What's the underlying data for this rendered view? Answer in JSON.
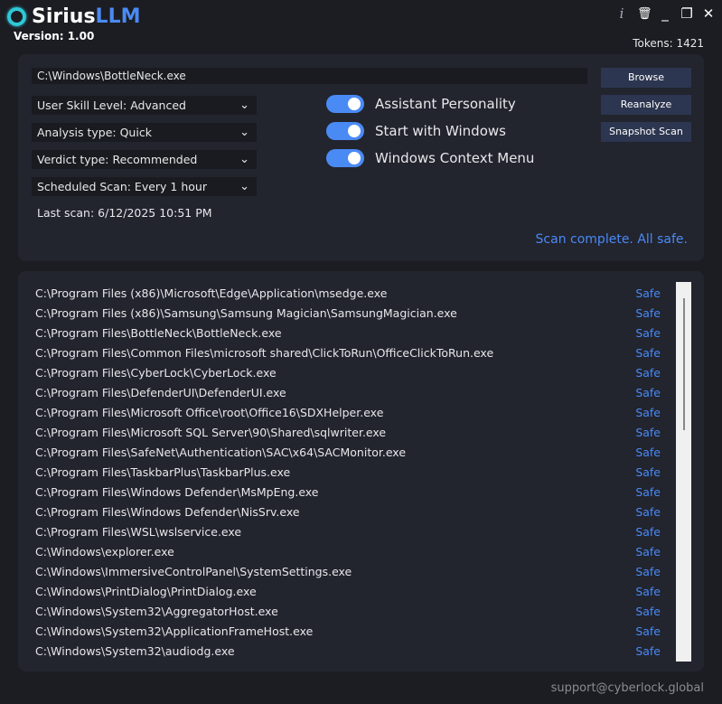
{
  "app": {
    "name_main": "Sirius",
    "name_accent": "LLM",
    "version": "Version: 1.00",
    "tokens": "Tokens: 1421"
  },
  "window_controls": {
    "info": "i",
    "delete": "🗑",
    "minimize": "_",
    "restore": "❐",
    "close": "✕"
  },
  "settings": {
    "file_path": "C:\\Windows\\BottleNeck.exe",
    "dropdowns": [
      {
        "label": "User Skill Level: Advanced"
      },
      {
        "label": "Analysis type: Quick"
      },
      {
        "label": "Verdict type: Recommended"
      },
      {
        "label": "Scheduled Scan: Every 1 hour"
      }
    ],
    "last_scan": "Last scan: 6/12/2025 10:51 PM",
    "toggles": [
      {
        "label": "Assistant Personality",
        "on": true
      },
      {
        "label": "Start with Windows",
        "on": true
      },
      {
        "label": "Windows Context Menu",
        "on": true
      }
    ],
    "buttons": {
      "browse": "Browse",
      "reanalyze": "Reanalyze",
      "snapshot": "Snapshot Scan"
    },
    "status": "Scan complete. All safe."
  },
  "results": [
    {
      "path": "C:\\Program Files (x86)\\Microsoft\\Edge\\Application\\msedge.exe",
      "verdict": "Safe"
    },
    {
      "path": "C:\\Program Files (x86)\\Samsung\\Samsung Magician\\SamsungMagician.exe",
      "verdict": "Safe"
    },
    {
      "path": "C:\\Program Files\\BottleNeck\\BottleNeck.exe",
      "verdict": "Safe"
    },
    {
      "path": "C:\\Program Files\\Common Files\\microsoft shared\\ClickToRun\\OfficeClickToRun.exe",
      "verdict": "Safe"
    },
    {
      "path": "C:\\Program Files\\CyberLock\\CyberLock.exe",
      "verdict": "Safe"
    },
    {
      "path": "C:\\Program Files\\DefenderUI\\DefenderUI.exe",
      "verdict": "Safe"
    },
    {
      "path": "C:\\Program Files\\Microsoft Office\\root\\Office16\\SDXHelper.exe",
      "verdict": "Safe"
    },
    {
      "path": "C:\\Program Files\\Microsoft SQL Server\\90\\Shared\\sqlwriter.exe",
      "verdict": "Safe"
    },
    {
      "path": "C:\\Program Files\\SafeNet\\Authentication\\SAC\\x64\\SACMonitor.exe",
      "verdict": "Safe"
    },
    {
      "path": "C:\\Program Files\\TaskbarPlus\\TaskbarPlus.exe",
      "verdict": "Safe"
    },
    {
      "path": "C:\\Program Files\\Windows Defender\\MsMpEng.exe",
      "verdict": "Safe"
    },
    {
      "path": "C:\\Program Files\\Windows Defender\\NisSrv.exe",
      "verdict": "Safe"
    },
    {
      "path": "C:\\Program Files\\WSL\\wslservice.exe",
      "verdict": "Safe"
    },
    {
      "path": "C:\\Windows\\explorer.exe",
      "verdict": "Safe"
    },
    {
      "path": "C:\\Windows\\ImmersiveControlPanel\\SystemSettings.exe",
      "verdict": "Safe"
    },
    {
      "path": "C:\\Windows\\PrintDialog\\PrintDialog.exe",
      "verdict": "Safe"
    },
    {
      "path": "C:\\Windows\\System32\\AggregatorHost.exe",
      "verdict": "Safe"
    },
    {
      "path": "C:\\Windows\\System32\\ApplicationFrameHost.exe",
      "verdict": "Safe"
    },
    {
      "path": "C:\\Windows\\System32\\audiodg.exe",
      "verdict": "Safe"
    }
  ],
  "footer": {
    "support": "support@cyberlock.global"
  },
  "colors": {
    "accent": "#4a8af4",
    "logo_ring": "#2ec9d8",
    "background": "#1c1d22",
    "panel": "#22242e"
  }
}
